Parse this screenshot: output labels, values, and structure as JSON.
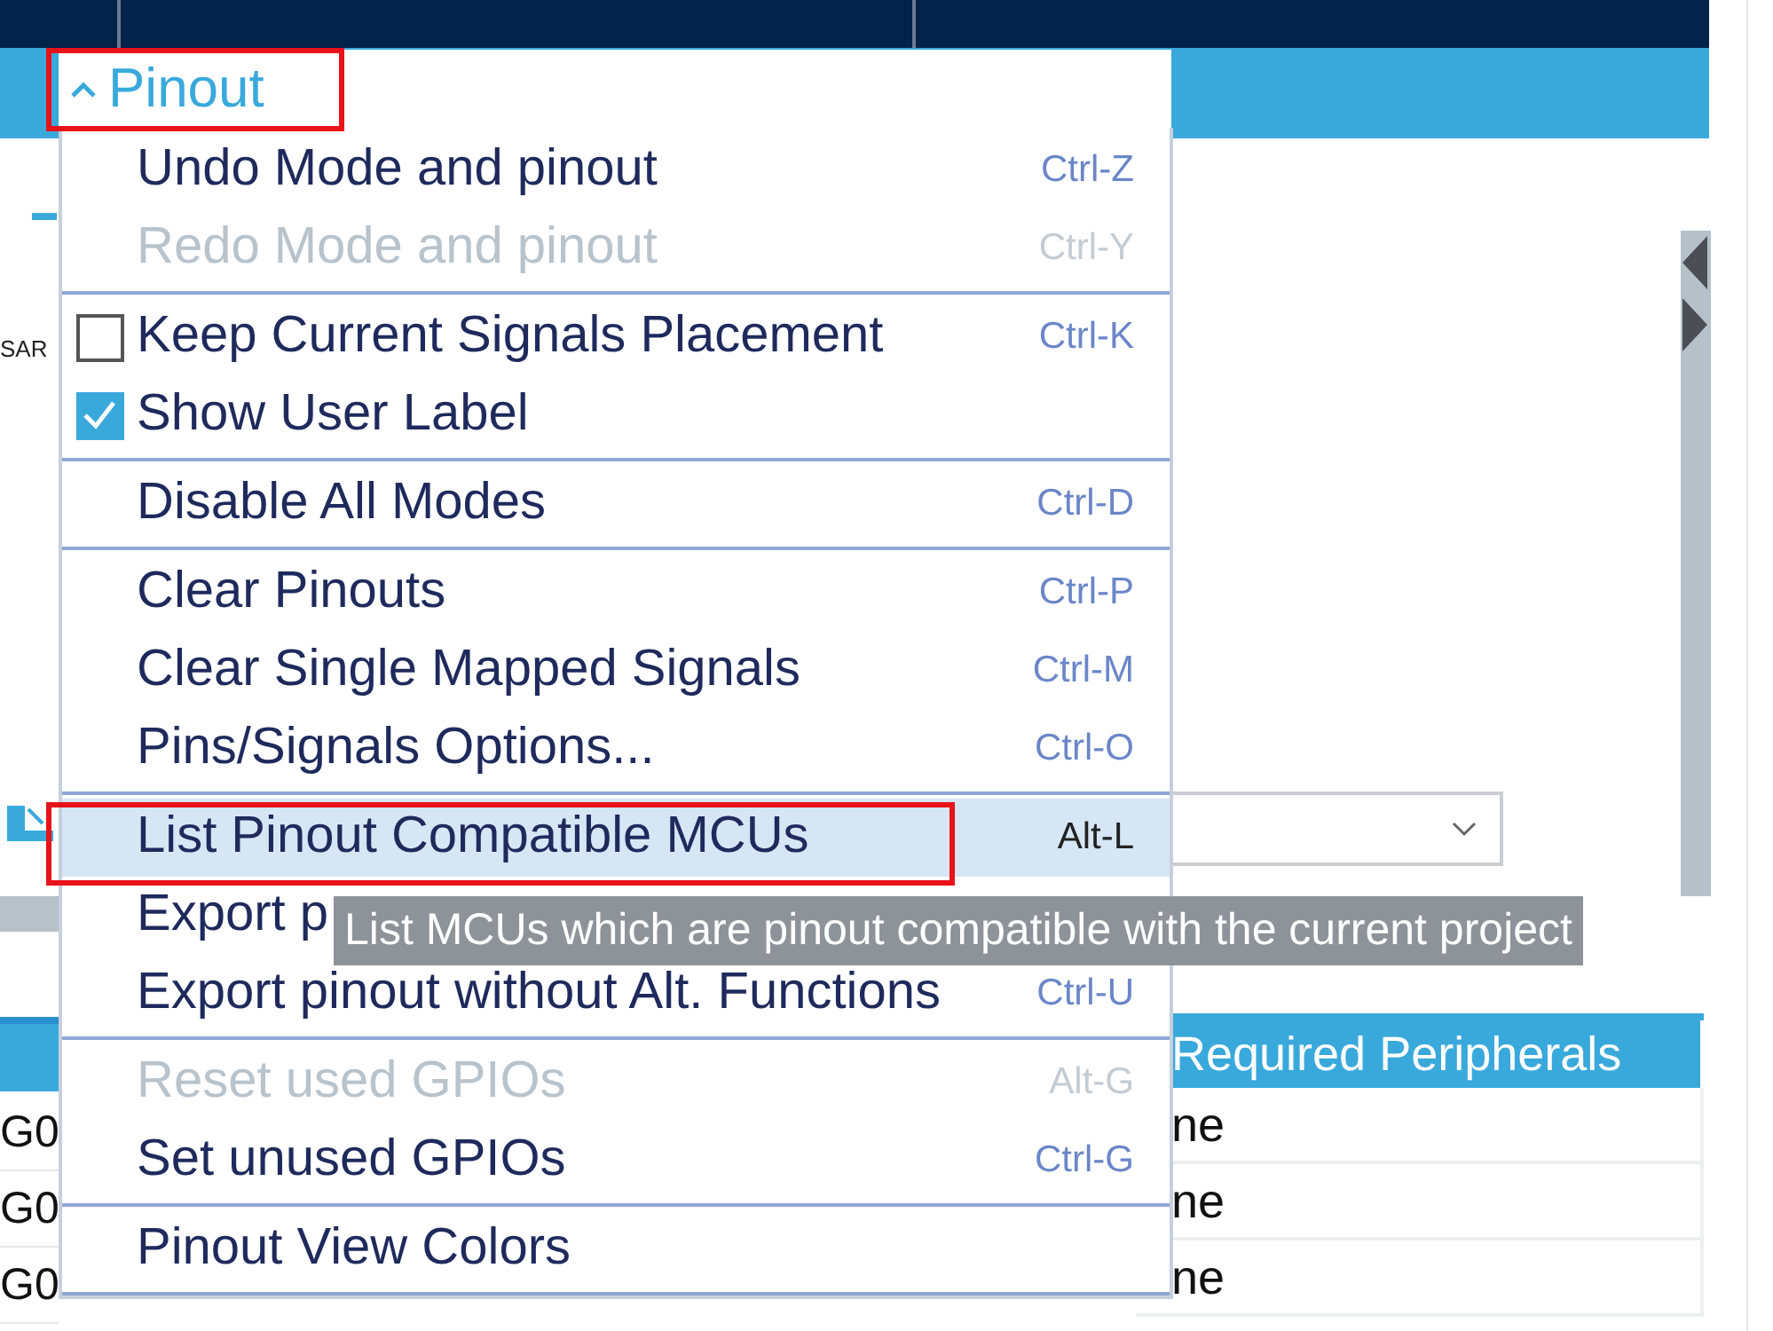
{
  "background": {
    "side_label": "SAR",
    "left_cells": [
      "G0",
      "G0",
      "G0"
    ],
    "table": {
      "columns": [
        "Required Peripherals"
      ],
      "rows": [
        "ne",
        "ne",
        "ne"
      ]
    }
  },
  "menu": {
    "header": {
      "label": "Pinout",
      "annotated": true
    },
    "groups": [
      [
        {
          "kind": "command",
          "label": "Undo Mode and pinout",
          "shortcut": "Ctrl-Z",
          "disabled": false,
          "selected": false,
          "annotated": false
        },
        {
          "kind": "command",
          "label": "Redo Mode and pinout",
          "shortcut": "Ctrl-Y",
          "disabled": true,
          "selected": false,
          "annotated": false
        }
      ],
      [
        {
          "kind": "checkbox",
          "label": "Keep Current Signals Placement",
          "shortcut": "Ctrl-K",
          "checked": false,
          "disabled": false,
          "selected": false,
          "annotated": false
        },
        {
          "kind": "checkbox",
          "label": "Show User Label",
          "checked": true,
          "disabled": false,
          "selected": false,
          "annotated": false
        }
      ],
      [
        {
          "kind": "command",
          "label": "Disable All Modes",
          "shortcut": "Ctrl-D",
          "disabled": false,
          "selected": false,
          "annotated": false
        }
      ],
      [
        {
          "kind": "command",
          "label": "Clear Pinouts",
          "shortcut": "Ctrl-P",
          "disabled": false,
          "selected": false,
          "annotated": false
        },
        {
          "kind": "command",
          "label": "Clear Single Mapped Signals",
          "shortcut": "Ctrl-M",
          "disabled": false,
          "selected": false,
          "annotated": false
        },
        {
          "kind": "command",
          "label": "Pins/Signals Options...",
          "shortcut": "Ctrl-O",
          "disabled": false,
          "selected": false,
          "annotated": false
        }
      ],
      [
        {
          "kind": "command",
          "label": "List Pinout Compatible MCUs",
          "shortcut": "Alt-L",
          "disabled": false,
          "selected": true,
          "annotated": true
        },
        {
          "kind": "command",
          "label": "Export p",
          "disabled": false,
          "selected": false,
          "annotated": false
        },
        {
          "kind": "command",
          "label": "Export pinout without Alt. Functions",
          "shortcut": "Ctrl-U",
          "disabled": false,
          "selected": false,
          "annotated": false
        }
      ],
      [
        {
          "kind": "command",
          "label": "Reset used GPIOs",
          "shortcut": "Alt-G",
          "disabled": true,
          "selected": false,
          "annotated": false
        },
        {
          "kind": "command",
          "label": "Set unused GPIOs",
          "shortcut": "Ctrl-G",
          "disabled": false,
          "selected": false,
          "annotated": false
        }
      ],
      [
        {
          "kind": "command",
          "label": "Pinout View Colors",
          "disabled": false,
          "selected": false,
          "annotated": false
        }
      ]
    ]
  },
  "tooltip": "List MCUs which are pinout compatible with the current project"
}
